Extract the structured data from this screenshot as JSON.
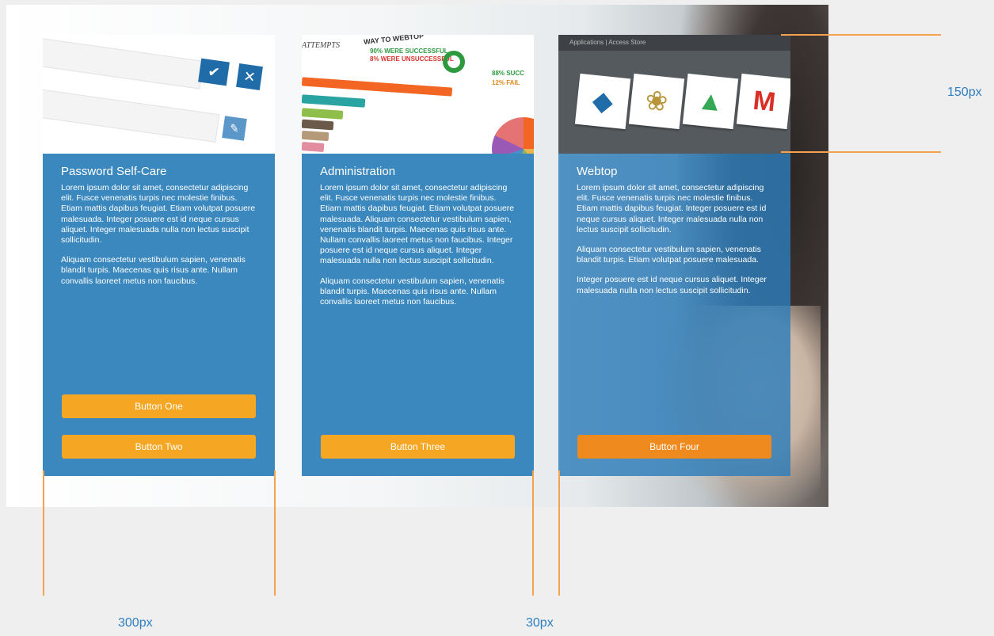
{
  "cards": [
    {
      "title": "Password Self-Care",
      "paragraphs": [
        "Lorem ipsum dolor sit amet, consectetur adipiscing elit. Fusce venenatis turpis nec molestie finibus. Etiam mattis dapibus feugiat. Etiam volutpat posuere malesuada. Integer posuere est id neque cursus aliquet. Integer malesuada nulla non lectus suscipit sollicitudin.",
        "Aliquam consectetur vestibulum sapien, venenatis blandit turpis. Maecenas quis risus ante. Nullam convallis laoreet metus non faucibus."
      ],
      "buttons": [
        "Button One",
        "Button Two"
      ],
      "image": {
        "check_icon": "✔",
        "close_icon": "✕",
        "edit_icon": "✎"
      }
    },
    {
      "title": "Administration",
      "paragraphs": [
        "Lorem ipsum dolor sit amet, consectetur adipiscing elit. Fusce venenatis turpis nec molestie finibus. Etiam mattis dapibus feugiat. Etiam volutpat posuere malesuada. Aliquam consectetur vestibulum sapien, venenatis blandit turpis. Maecenas quis risus ante. Nullam convallis laoreet metus non faucibus. Integer posuere est id neque cursus aliquet. Integer malesuada nulla non lectus suscipit sollicitudin.",
        "Aliquam consectetur vestibulum sapien, venenatis blandit turpis. Maecenas quis risus ante. Nullam convallis laoreet metus non faucibus."
      ],
      "buttons": [
        "Button Three"
      ],
      "image": {
        "label": "ATTEMPTS",
        "heading": "WAY TO WEBTOP",
        "stat_success": "90% WERE SUCCESSFUL",
        "stat_fail": "8% WERE UNSUCCESSFUL",
        "stat_right_success": "88% SUCC",
        "stat_right_fail": "12% FAIL"
      }
    },
    {
      "title": "Webtop",
      "paragraphs": [
        "Lorem ipsum dolor sit amet, consectetur adipiscing elit. Fusce venenatis turpis nec molestie finibus. Etiam mattis dapibus feugiat. Integer posuere est id neque cursus aliquet. Integer malesuada nulla non lectus suscipit sollicitudin.",
        "Aliquam consectetur vestibulum sapien, venenatis blandit turpis. Etiam volutpat posuere malesuada.",
        "Integer posuere est id neque cursus aliquet. Integer malesuada nulla non lectus suscipit sollicitudin."
      ],
      "buttons": [
        "Button Four"
      ],
      "image": {
        "topbar": "Applications  |  Access Store",
        "tiles": [
          "◆",
          "❀",
          "▲",
          "M"
        ]
      }
    }
  ],
  "annotations": {
    "height_label": "150px",
    "width_label": "300px",
    "gap_label": "30px"
  },
  "colors": {
    "card_blue": "#3a88be",
    "button_orange": "#f5a623",
    "button_orange_dark": "#ef8a1e",
    "annotation_line": "#f4a24d",
    "annotation_text": "#2f7fc1"
  }
}
